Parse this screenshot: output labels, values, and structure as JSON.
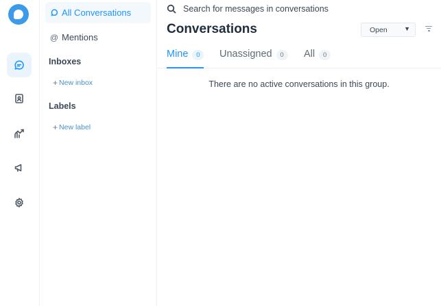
{
  "rail": {
    "items": [
      {
        "name": "conversations",
        "icon": "chat-bubble-icon",
        "active": true
      },
      {
        "name": "contacts",
        "icon": "contact-book-icon",
        "active": false
      },
      {
        "name": "reports",
        "icon": "trend-chart-icon",
        "active": false
      },
      {
        "name": "campaigns",
        "icon": "megaphone-icon",
        "active": false
      },
      {
        "name": "settings",
        "icon": "gear-icon",
        "active": false
      }
    ]
  },
  "sidebar": {
    "all_conversations": "All Conversations",
    "mentions": "Mentions",
    "mentions_symbol": "@",
    "inboxes_title": "Inboxes",
    "new_inbox": "New inbox",
    "labels_title": "Labels",
    "new_label": "New label",
    "plus_symbol": "+"
  },
  "main": {
    "search_placeholder": "Search for messages in conversations",
    "title": "Conversations",
    "status_filter": "Open",
    "tabs": [
      {
        "label": "Mine",
        "count": "0",
        "active": true
      },
      {
        "label": "Unassigned",
        "count": "0",
        "active": false
      },
      {
        "label": "All",
        "count": "0",
        "active": false
      }
    ],
    "empty_message": "There are no active conversations in this group."
  },
  "colors": {
    "accent": "#1f93ff",
    "logo": "#3c9ae8",
    "active_bg": "#eaf4fd"
  }
}
